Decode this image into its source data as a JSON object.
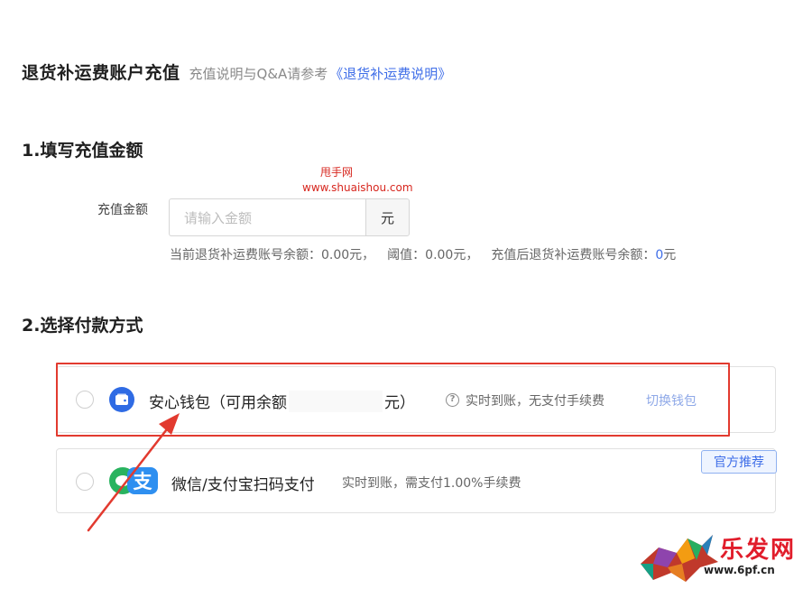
{
  "header": {
    "title": "退货补运费账户充值",
    "note": "充值说明与Q&A请参考",
    "link": "《退货补运费说明》"
  },
  "watermark": {
    "line1": "甩手网",
    "line2": "www.shuaishou.com"
  },
  "step1": {
    "title": "1.填写充值金额",
    "amount_label": "充值金额",
    "input_placeholder": "请输入金额",
    "unit": "元",
    "balance_current": "当前退货补运费账号余额：0.00元，",
    "threshold": "阈值：0.00元，",
    "balance_after_label": "充值后退货补运费账号余额：",
    "balance_after_value": "0",
    "balance_after_unit": "元"
  },
  "step2": {
    "title": "2.选择付款方式",
    "wallet": {
      "label_prefix": "安心钱包（可用余额",
      "label_suffix": "元）",
      "desc": "实时到账，无支付手续费",
      "switch": "切换钱包"
    },
    "scan": {
      "label": "微信/支付宝扫码支付",
      "desc": "实时到账，需支付1.00%手续费",
      "badge": "官方推荐"
    }
  },
  "logo": {
    "text": "乐发网",
    "url": "www.6pf.cn"
  },
  "colors": {
    "accent": "#3f6ee8",
    "highlight": "#e23a2f",
    "wechat": "#29b35f",
    "alipay": "#2e8ff0"
  },
  "icons": [
    "wallet-icon",
    "help-icon",
    "wechat-icon",
    "alipay-icon"
  ]
}
